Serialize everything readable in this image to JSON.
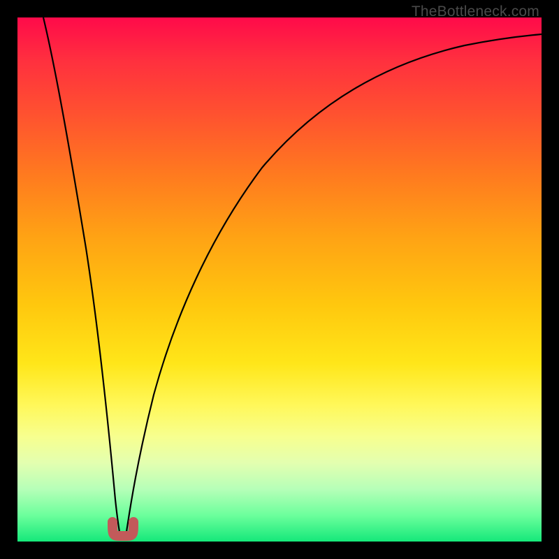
{
  "attribution": "TheBottleneck.com",
  "chart_data": {
    "type": "line",
    "title": "",
    "xlabel": "",
    "ylabel": "",
    "xlim": [
      0,
      100
    ],
    "ylim": [
      0,
      100
    ],
    "grid": false,
    "legend": false,
    "notes": "Rainbow vertical gradient background (red top → green bottom). Two black curves form a V with minimum near x≈19, y≈0. A short rosy-red U-shaped marker sits at the V's minimum.",
    "series": [
      {
        "name": "left-branch",
        "x": [
          5,
          7,
          9,
          11,
          13,
          15,
          17,
          18.5
        ],
        "y": [
          100,
          85,
          70,
          54,
          38,
          23,
          9,
          2
        ]
      },
      {
        "name": "right-branch",
        "x": [
          20.5,
          22,
          25,
          30,
          37,
          46,
          56,
          68,
          82,
          100
        ],
        "y": [
          2,
          10,
          25,
          43,
          60,
          73,
          82,
          89,
          93,
          96
        ]
      }
    ],
    "marker": {
      "name": "min-marker",
      "color": "#c25a5a",
      "x_center": 19.5,
      "y_center": 1.5,
      "width": 4,
      "height": 3
    }
  }
}
